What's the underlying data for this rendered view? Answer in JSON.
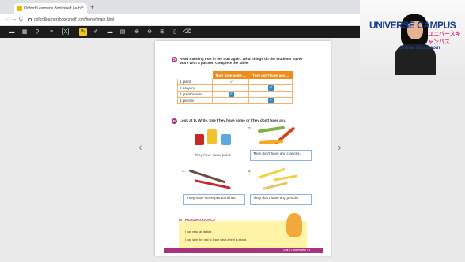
{
  "browser": {
    "tab_title": "Oxford Learner's Bookshelf | e-b",
    "tab_close": "×",
    "new_tab": "+",
    "url": "oxfordlearnersbookshelf.com/home/main.html",
    "nav": {
      "back": "←",
      "forward": "→",
      "reload": "C"
    }
  },
  "toolbar": {
    "icons": [
      "menu-icon",
      "grid-icon",
      "search-icon",
      "list-icon",
      "fit-icon",
      "pen-icon",
      "marker-icon",
      "note-icon",
      "comment-icon",
      "zoom-in-icon",
      "zoom-out-icon",
      "layout-icon",
      "page-icon",
      "eraser-icon"
    ],
    "glyphs": [
      "▬",
      "▦",
      "⚲",
      "≡",
      "[X]",
      "✎",
      "✐",
      "▬",
      "▤",
      "⊕",
      "⊖",
      "⊞",
      "▯",
      "⌫"
    ],
    "active_index": 5
  },
  "viewer": {
    "prev": "‹",
    "next": "›"
  },
  "page": {
    "ex1_badge": "D",
    "ex1_instr": "Read Painting Fun in the Sun again. What things do the students have? Work with a partner. Complete the table.",
    "table_head": [
      "",
      "They have some ...",
      "They don't have any ..."
    ],
    "table_rows": [
      {
        "item": "1. paint",
        "some": "✓",
        "some_checked": false,
        "any_checked": false
      },
      {
        "item": "2. crayons",
        "some": "",
        "some_checked": false,
        "any_checked": true
      },
      {
        "item": "3. paintbrushes",
        "some": "",
        "some_checked": true,
        "any_checked": false
      },
      {
        "item": "4. pencils",
        "some": "",
        "some_checked": false,
        "any_checked": true
      }
    ],
    "ex2_badge": "E",
    "ex2_instr": "Look at D. Write. Use They have some or They don't have any.",
    "nums": [
      "1.",
      "2.",
      "3.",
      "4."
    ],
    "answers": [
      "They have some paint.",
      "They don't have any crayons.",
      "They have some paintbrushes.",
      "They don't have any pencils."
    ],
    "goals_title": "MY READING GOALS",
    "goals_lines": [
      "I can read an article.",
      "I can skim for gist to learn what a text is about."
    ],
    "footer": "Unit 1  Understand   13"
  },
  "webcam": {
    "logo": "UNIVERSE CAMPUS",
    "logo_jp": "ユニバースキャンパス",
    "tagline": "Online Classroom"
  },
  "colors": {
    "accent": "#f08c1c",
    "brand": "#a8327b",
    "check": "#2a8ad4"
  }
}
